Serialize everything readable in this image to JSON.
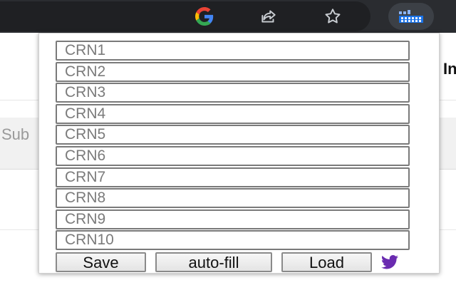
{
  "toolbar": {
    "icons": [
      "google-icon",
      "share-icon",
      "star-icon",
      "extension-icon"
    ]
  },
  "page": {
    "left_text": "Sub",
    "right_text": "In"
  },
  "popup": {
    "crn_fields": [
      {
        "placeholder": "CRN1",
        "value": ""
      },
      {
        "placeholder": "CRN2",
        "value": ""
      },
      {
        "placeholder": "CRN3",
        "value": ""
      },
      {
        "placeholder": "CRN4",
        "value": ""
      },
      {
        "placeholder": "CRN5",
        "value": ""
      },
      {
        "placeholder": "CRN6",
        "value": ""
      },
      {
        "placeholder": "CRN7",
        "value": ""
      },
      {
        "placeholder": "CRN8",
        "value": ""
      },
      {
        "placeholder": "CRN9",
        "value": ""
      },
      {
        "placeholder": "CRN10",
        "value": ""
      }
    ],
    "buttons": {
      "save": "Save",
      "autofill": "auto-fill",
      "load": "Load"
    },
    "twitter_icon": "twitter-icon",
    "twitter_color": "#6a2bb0"
  }
}
